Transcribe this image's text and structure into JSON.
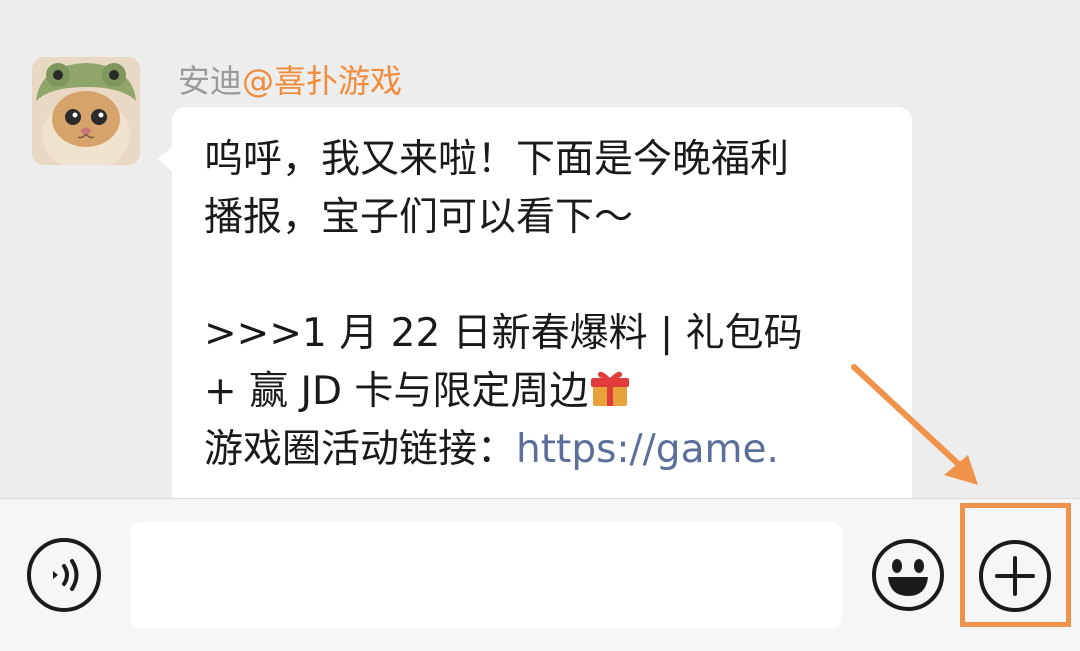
{
  "message": {
    "sender_name": "安迪",
    "sender_mention": "@喜扑游戏",
    "lines": [
      "呜呼，我又来啦！下面是今晚福利",
      "播报，宝子们可以看下～",
      "",
      ">>>1 月 22 日新春爆料 | 礼包码",
      "+ 赢 JD 卡与限定周边",
      "游戏圈活动链接："
    ],
    "link_text": "https://game.",
    "gift_emoji": "gift-icon"
  },
  "input_bar": {
    "voice_icon": "voice-icon",
    "input_value": "",
    "emoji_icon": "smiley-icon",
    "plus_icon": "plus-icon"
  },
  "annotation": {
    "color": "#f0934a"
  },
  "colors": {
    "mention": "#f08c3a",
    "link": "#5b6f9a",
    "background": "#ededed"
  }
}
